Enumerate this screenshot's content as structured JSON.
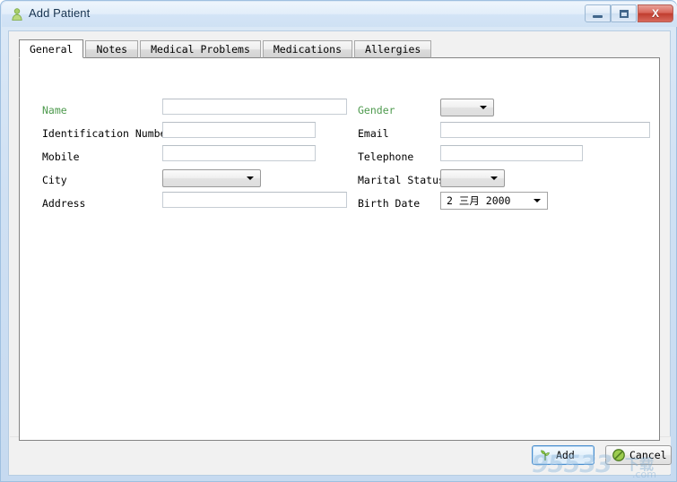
{
  "window": {
    "title": "Add Patient",
    "icon": "patient-person-icon",
    "controls": {
      "minimize_label": "Minimize",
      "maximize_label": "Restore",
      "close_label": "Close",
      "close_glyph": "X",
      "close_color": "#c03d2f"
    },
    "titlebar_color": "#d3e4f6",
    "border_color": "#9fc0e0"
  },
  "tabs": [
    {
      "label": "General",
      "active": true
    },
    {
      "label": "Notes",
      "active": false
    },
    {
      "label": "Medical Problems",
      "active": false
    },
    {
      "label": "Medications",
      "active": false
    },
    {
      "label": "Allergies",
      "active": false
    }
  ],
  "form": {
    "required_color": "#4e9a4e",
    "left_column": [
      {
        "label": "Name",
        "required": true,
        "control": "textbox",
        "value": "",
        "placeholder": ""
      },
      {
        "label": "Identification Number",
        "required": false,
        "control": "textbox",
        "value": "",
        "placeholder": ""
      },
      {
        "label": "Mobile",
        "required": false,
        "control": "textbox",
        "value": "",
        "placeholder": ""
      },
      {
        "label": "City",
        "required": false,
        "control": "combobox",
        "value": ""
      },
      {
        "label": "Address",
        "required": false,
        "control": "textbox",
        "value": "",
        "placeholder": ""
      }
    ],
    "right_column": [
      {
        "label": "Gender",
        "required": true,
        "control": "combobox",
        "value": ""
      },
      {
        "label": "Email",
        "required": false,
        "control": "textbox",
        "value": "",
        "placeholder": ""
      },
      {
        "label": "Telephone",
        "required": false,
        "control": "textbox",
        "value": "",
        "placeholder": ""
      },
      {
        "label": "Marital Status",
        "required": false,
        "control": "combobox",
        "value": ""
      },
      {
        "label": "Birth Date",
        "required": false,
        "control": "datepicker",
        "value": "2 三月 2000"
      }
    ]
  },
  "footer": {
    "add_label": "Add",
    "add_icon": "green-plus-plant-icon",
    "cancel_label": "Cancel",
    "cancel_icon": "green-cancel-circle-icon"
  },
  "watermark": {
    "main": "95533",
    "cn": "下载",
    "com": ".com"
  }
}
